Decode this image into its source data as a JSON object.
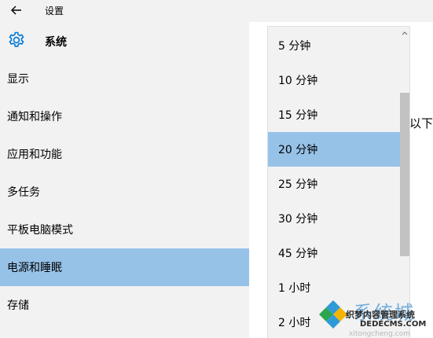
{
  "titlebar": {
    "back_icon": "back-arrow-icon",
    "title": "设置"
  },
  "sidebar": {
    "header_icon": "gear-icon",
    "title": "系统",
    "items": [
      {
        "label": "显示",
        "selected": false
      },
      {
        "label": "通知和操作",
        "selected": false
      },
      {
        "label": "应用和功能",
        "selected": false
      },
      {
        "label": "多任务",
        "selected": false
      },
      {
        "label": "平板电脑模式",
        "selected": false
      },
      {
        "label": "电源和睡眠",
        "selected": true
      },
      {
        "label": "存储",
        "selected": false
      }
    ]
  },
  "content": {
    "partial_text": "以下"
  },
  "dropdown": {
    "selected": "20 分钟",
    "options": [
      "5 分钟",
      "10 分钟",
      "15 分钟",
      "20 分钟",
      "25 分钟",
      "30 分钟",
      "45 分钟",
      "1 小时",
      "2 小时"
    ]
  },
  "watermark": {
    "big": "系统城",
    "line1": "织梦内容管理系统",
    "line2": "DEDECMS.COM",
    "line3": "xitongcheng.com"
  },
  "colors": {
    "selected": "#96c2e8",
    "panel": "#f2f2f2",
    "accent": "#0078d7"
  }
}
